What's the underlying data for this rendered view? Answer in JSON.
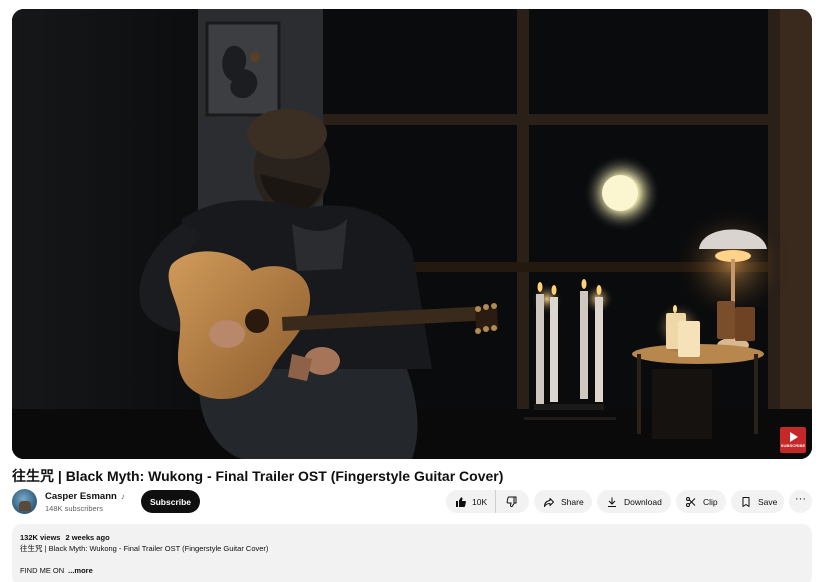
{
  "player": {
    "watermark_text": "SUBSCRIBE"
  },
  "video": {
    "title": "往生咒 | Black Myth: Wukong - Final Trailer OST (Fingerstyle Guitar Cover)"
  },
  "channel": {
    "name": "Casper Esmann",
    "subscribers": "148K subscribers",
    "subscribe_label": "Subscribe",
    "badge_icon": "music-note-icon"
  },
  "actions": {
    "like_count": "10K",
    "share_label": "Share",
    "download_label": "Download",
    "clip_label": "Clip",
    "save_label": "Save",
    "more_label": "···"
  },
  "description": {
    "views": "132K views",
    "age": "2 weeks ago",
    "line1": "往生咒 | Black Myth: Wukong - Final Trailer OST (Fingerstyle Guitar Cover)",
    "line2": "FIND ME ON",
    "more_label": "...more"
  },
  "colors": {
    "subscribe_bg": "#0f0f0f",
    "pill_bg": "#f2f2f2",
    "watermark_red": "#c62828"
  }
}
